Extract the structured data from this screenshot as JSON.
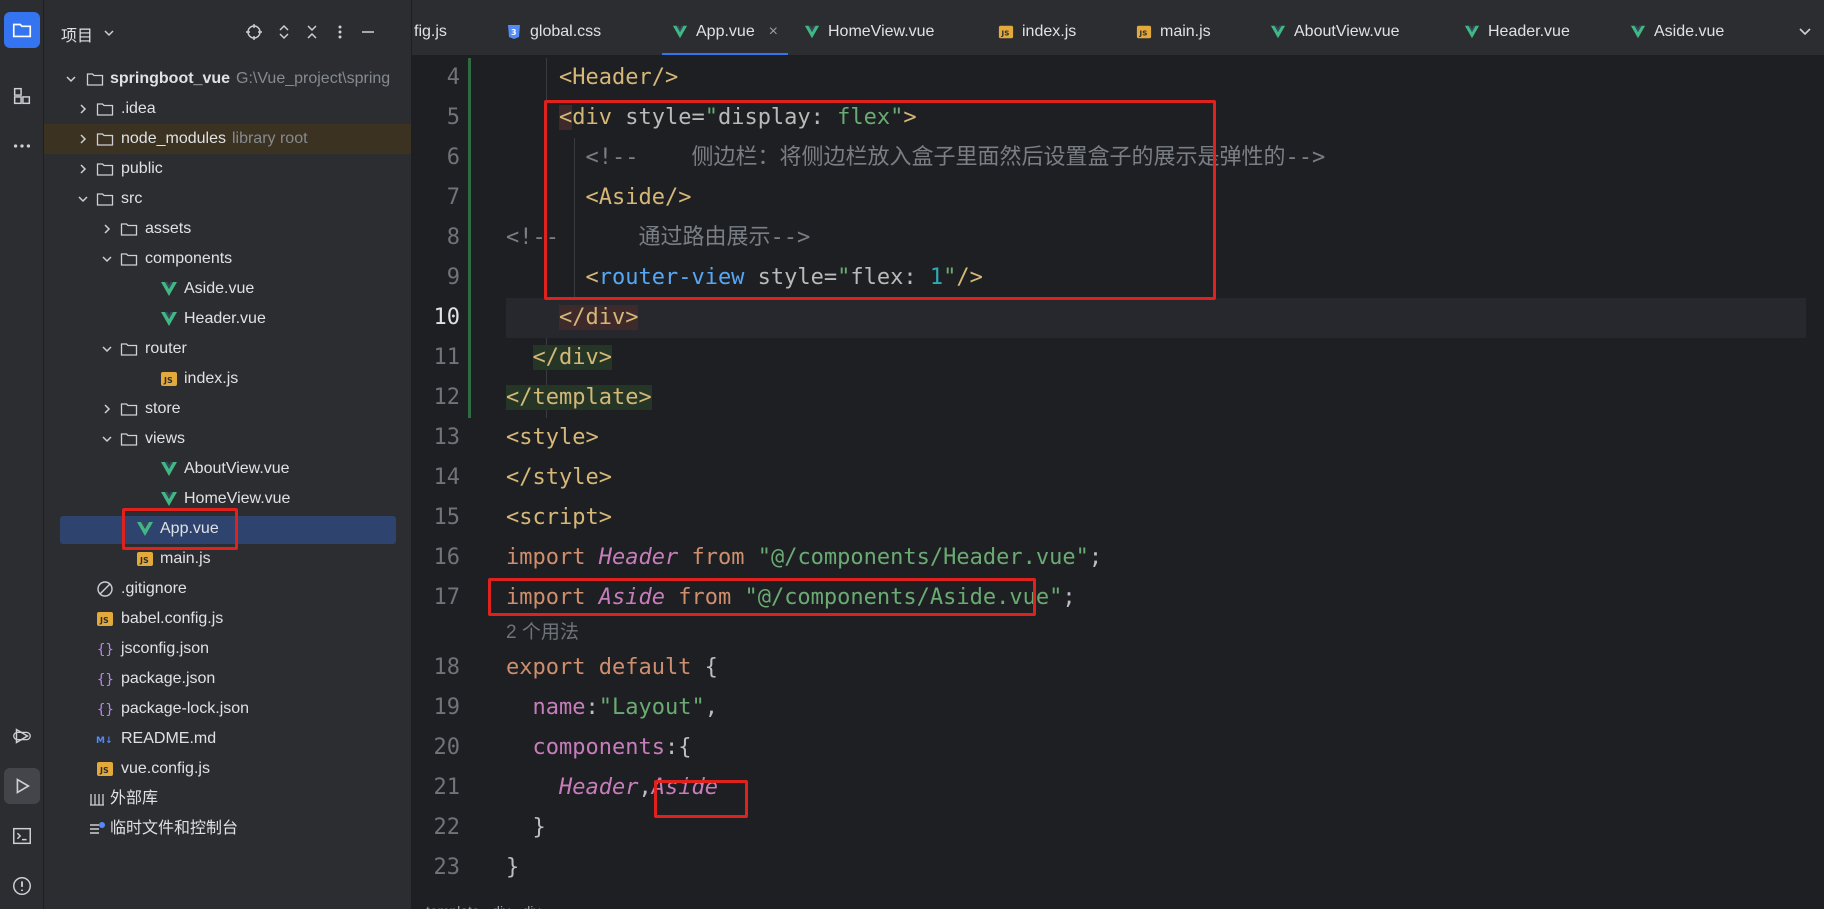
{
  "top_accent_color": "#3574f0",
  "project_panel": {
    "title": "项目",
    "root": {
      "name": "springboot_vue",
      "path": "G:\\Vue_project\\spring"
    },
    "items": [
      {
        "label": ".idea",
        "icon": "folder-icon"
      },
      {
        "label": "node_modules",
        "hint": "library root",
        "icon": "folder-icon"
      },
      {
        "label": "public",
        "icon": "folder-icon"
      },
      {
        "label": "src",
        "icon": "folder-icon"
      },
      {
        "label": "assets",
        "icon": "folder-icon"
      },
      {
        "label": "components",
        "icon": "folder-icon"
      },
      {
        "label": "Aside.vue",
        "icon": "vue-icon"
      },
      {
        "label": "Header.vue",
        "icon": "vue-icon"
      },
      {
        "label": "router",
        "icon": "folder-icon"
      },
      {
        "label": "index.js",
        "icon": "js-icon"
      },
      {
        "label": "store",
        "icon": "folder-icon"
      },
      {
        "label": "views",
        "icon": "folder-icon"
      },
      {
        "label": "AboutView.vue",
        "icon": "vue-icon"
      },
      {
        "label": "HomeView.vue",
        "icon": "vue-icon"
      },
      {
        "label": "App.vue",
        "icon": "vue-icon"
      },
      {
        "label": "main.js",
        "icon": "js-icon"
      },
      {
        "label": ".gitignore",
        "icon": "ignore-icon"
      },
      {
        "label": "babel.config.js",
        "icon": "js-icon"
      },
      {
        "label": "jsconfig.json",
        "icon": "json-icon"
      },
      {
        "label": "package.json",
        "icon": "json-icon"
      },
      {
        "label": "package-lock.json",
        "icon": "json-icon"
      },
      {
        "label": "README.md",
        "icon": "markdown-icon"
      },
      {
        "label": "vue.config.js",
        "icon": "js-icon"
      },
      {
        "label": "外部库",
        "icon": "library-icon"
      },
      {
        "label": "临时文件和控制台",
        "icon": "scratch-icon"
      }
    ]
  },
  "tabs": [
    {
      "label": "fig.js",
      "icon": "none"
    },
    {
      "label": "global.css",
      "icon": "css-icon"
    },
    {
      "label": "App.vue",
      "icon": "vue-icon",
      "close": "×"
    },
    {
      "label": "HomeView.vue",
      "icon": "vue-icon"
    },
    {
      "label": "index.js",
      "icon": "js-icon"
    },
    {
      "label": "main.js",
      "icon": "js-icon"
    },
    {
      "label": "AboutView.vue",
      "icon": "vue-icon"
    },
    {
      "label": "Header.vue",
      "icon": "vue-icon"
    },
    {
      "label": "Aside.vue",
      "icon": "vue-icon"
    }
  ],
  "editor": {
    "line_numbers": [
      "4",
      "5",
      "6",
      "7",
      "8",
      "9",
      "10",
      "11",
      "12",
      "13",
      "14",
      "15",
      "16",
      "17",
      "18",
      "19",
      "20",
      "21",
      "22",
      "23"
    ],
    "current_line": "10",
    "usage_hint": "2 个用法",
    "code": {
      "l4_open": "<",
      "l4_tag": "Header",
      "l4_close": "/>",
      "l5_lt": "<",
      "l5_tag": "div",
      "l5_attr": " style=",
      "l5_q1": "\"",
      "l5_v1": "display: ",
      "l5_v2": "flex",
      "l5_q2": "\"",
      "l5_gt": ">",
      "l6_cmt": "<!--    侧边栏：将侧边栏放入盒子里面然后设置盒子的展示是弹性的-->",
      "l7_lt": "<",
      "l7_tag": "Aside",
      "l7_close": "/>",
      "l8_cmt": "<!--      通过路由展示-->",
      "l9_lt": "<",
      "l9_tag": "router-view",
      "l9_attr": " style=",
      "l9_q1": "\"",
      "l9_v1": "flex: ",
      "l9_v2": "1",
      "l9_q2": "\"",
      "l9_close": "/>",
      "l10": "</div>",
      "l11": "</div>",
      "l12": "</template>",
      "l13": "<style>",
      "l14": "</style>",
      "l15": "<script>",
      "l16_kw": "import",
      "l16_id": "Header",
      "l16_from": "from",
      "l16_str": "\"@/components/Header.vue\"",
      "l16_end": ";",
      "l17_kw": "import",
      "l17_id": "Aside",
      "l17_from": "from",
      "l17_str": "\"@/components/Aside.vue\"",
      "l17_end": ";",
      "l18_kw": "export default",
      "l18_brace": " {",
      "l19_key": "name",
      "l19_colon": ":",
      "l19_str": "\"Layout\"",
      "l19_comma": ",",
      "l20_key": "components",
      "l20_rest": ":{",
      "l21_a": "Header",
      "l21_comma": ",",
      "l21_b": "Aside",
      "l22": "}",
      "l23": "}"
    }
  },
  "breadcrumb": [
    "template",
    "div",
    "div"
  ]
}
